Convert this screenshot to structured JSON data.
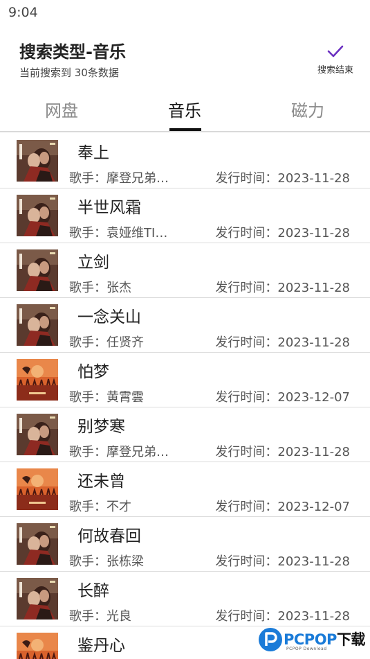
{
  "status_bar": {
    "time": "9:04"
  },
  "header": {
    "title": "搜索类型-音乐",
    "subtitle": "当前搜索到 30条数据",
    "done_label": "搜索结束",
    "accent_color": "#6a2fc1"
  },
  "tabs": [
    {
      "label": "网盘",
      "active": false
    },
    {
      "label": "音乐",
      "active": true
    },
    {
      "label": "磁力",
      "active": false
    }
  ],
  "songs": [
    {
      "title": "奉上",
      "artist": "歌手：摩登兄弟刘宇宁",
      "release": "发行时间：2023-11-28",
      "cover": "couple"
    },
    {
      "title": "半世风霜",
      "artist": "歌手：袁娅维TIA RAY",
      "release": "发行时间：2023-11-28",
      "cover": "couple"
    },
    {
      "title": "立剑",
      "artist": "歌手：张杰",
      "release": "发行时间：2023-11-28",
      "cover": "couple"
    },
    {
      "title": "一念关山",
      "artist": "歌手：任贤齐",
      "release": "发行时间：2023-11-28",
      "cover": "couple"
    },
    {
      "title": "怕梦",
      "artist": "歌手：黄霄雲",
      "release": "发行时间：2023-12-07",
      "cover": "army"
    },
    {
      "title": "别梦寒",
      "artist": "歌手：摩登兄弟刘宇宁",
      "release": "发行时间：2023-11-28",
      "cover": "couple"
    },
    {
      "title": "还未曾",
      "artist": "歌手：不才",
      "release": "发行时间：2023-12-07",
      "cover": "army"
    },
    {
      "title": "何故春回",
      "artist": "歌手：张栋梁",
      "release": "发行时间：2023-11-28",
      "cover": "couple"
    },
    {
      "title": "长醉",
      "artist": "歌手：光良",
      "release": "发行时间：2023-11-28",
      "cover": "couple"
    },
    {
      "title": "鉴丹心",
      "artist": "",
      "release": "",
      "cover": "army"
    }
  ],
  "watermark": {
    "brand": "PCPOP",
    "suffix": "下载",
    "small": "PCPOP Download"
  }
}
